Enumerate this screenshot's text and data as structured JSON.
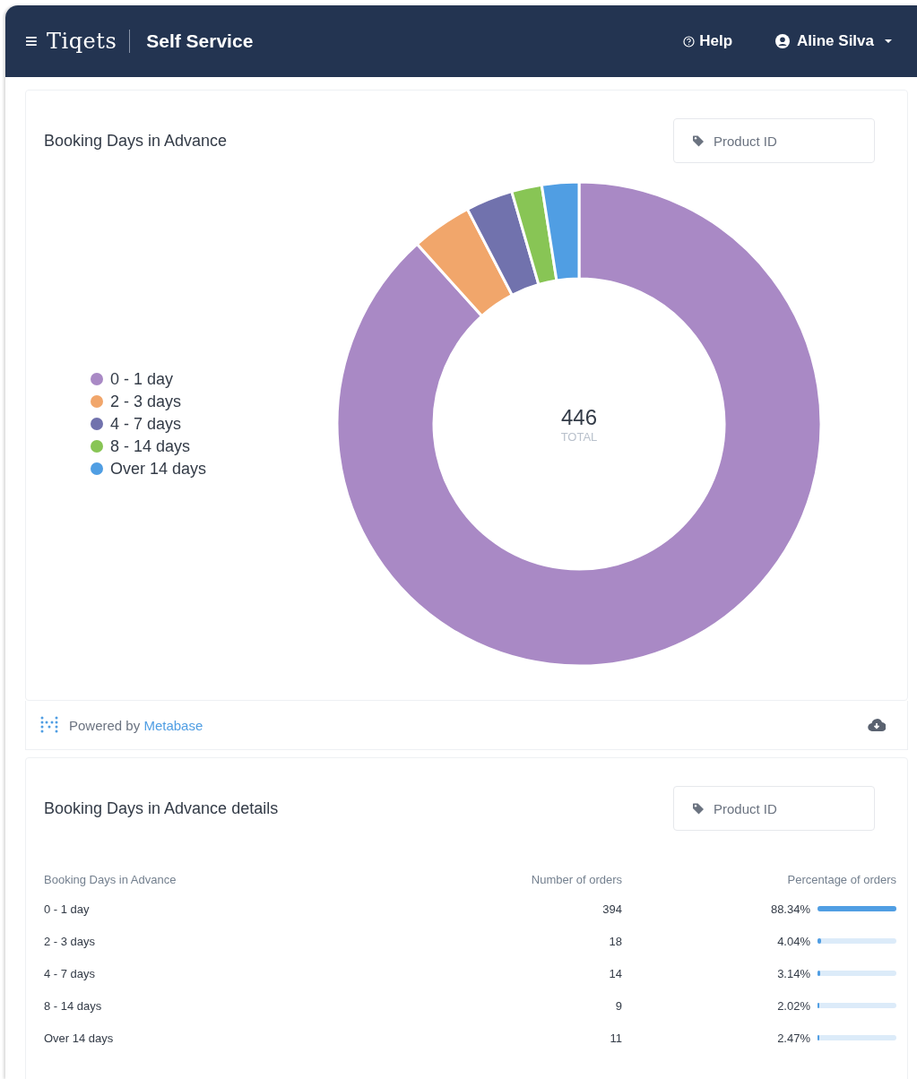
{
  "header": {
    "menu_icon": "≡",
    "brand": "Tiqets",
    "product": "Self Service",
    "help": "Help",
    "user": "Aline Silva"
  },
  "chart_card": {
    "title": "Booking Days in Advance",
    "filter": "Product ID",
    "total": "446",
    "total_label": "TOTAL",
    "chart_data": {
      "type": "donut",
      "categories": [
        "0 - 1 day",
        "2 - 3 days",
        "4 - 7 days",
        "8 - 14 days",
        "Over 14 days"
      ],
      "values": [
        88.34,
        4.04,
        3.14,
        2.02,
        2.47
      ],
      "colors": [
        "#a989c5",
        "#f1a66b",
        "#7172ad",
        "#88c555",
        "#509ee3"
      ]
    }
  },
  "footer": {
    "prefix": "Powered by",
    "link": "Metabase"
  },
  "table_card": {
    "title": "Booking Days in Advance details",
    "filter": "Product ID",
    "columns": [
      "Booking Days in Advance",
      "Number of orders",
      "Percentage of orders"
    ],
    "rows": [
      {
        "label": "0 - 1 day",
        "orders": "394",
        "percent": "88.34%",
        "level": 1
      },
      {
        "label": "2 - 3 days",
        "orders": "18",
        "percent": "4.04%",
        "level": 0.046
      },
      {
        "label": "4 - 7 days",
        "orders": "14",
        "percent": "3.14%",
        "level": 0.036
      },
      {
        "label": "8 - 14 days",
        "orders": "9",
        "percent": "2.02%",
        "level": 0.023
      },
      {
        "label": "Over 14 days",
        "orders": "11",
        "percent": "2.47%",
        "level": 0.028
      }
    ]
  }
}
